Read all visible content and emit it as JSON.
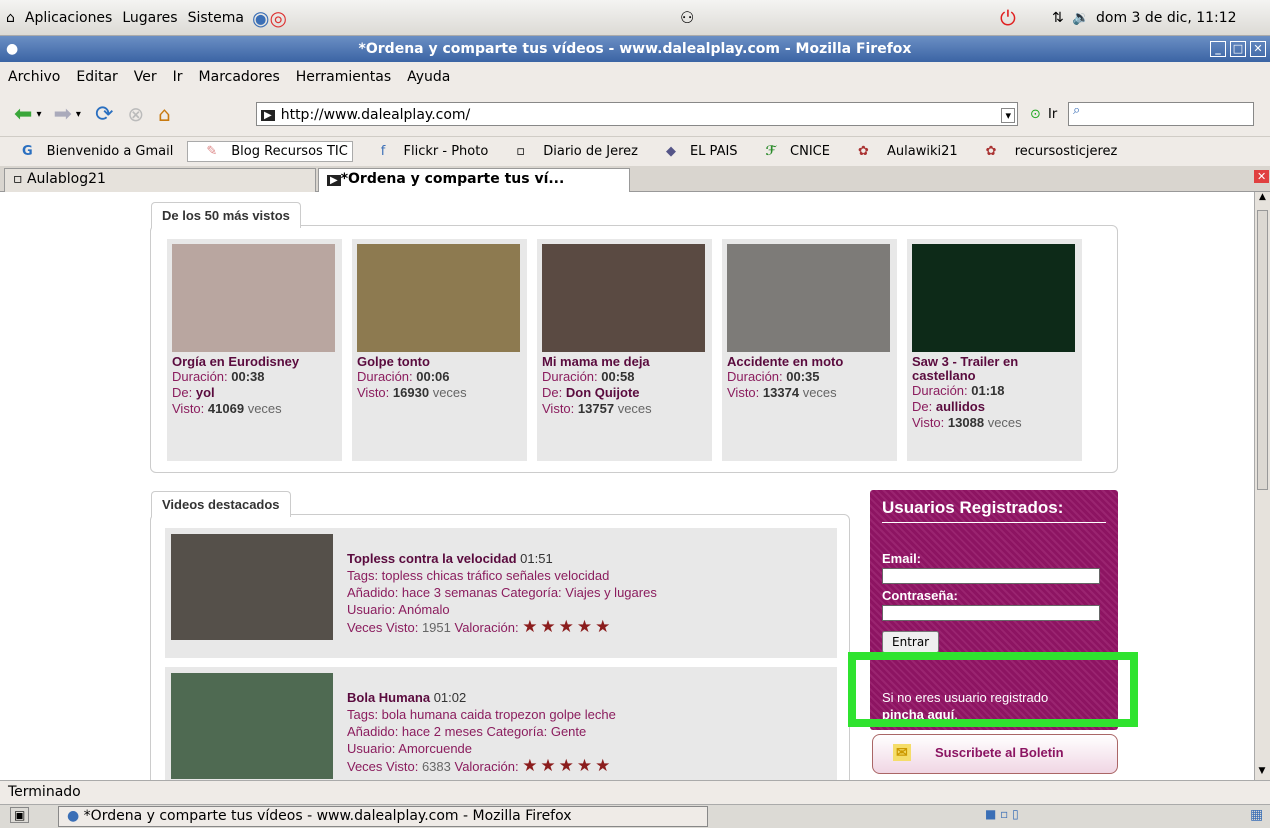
{
  "gnome_panel": {
    "menus": [
      "Aplicaciones",
      "Lugares",
      "Sistema"
    ],
    "clock": "dom 3 de dic, 11:12"
  },
  "window": {
    "title": "*Ordena y comparte tus vídeos - www.dalealplay.com - Mozilla Firefox"
  },
  "menubar": [
    "Archivo",
    "Editar",
    "Ver",
    "Ir",
    "Marcadores",
    "Herramientas",
    "Ayuda"
  ],
  "navbar": {
    "url": "http://www.dalealplay.com/",
    "go_label": "Ir"
  },
  "bookmarks": [
    "Bienvenido a Gmail",
    "Blog Recursos TIC",
    "Flickr - Photo",
    "Diario de Jerez",
    "EL PAIS",
    "CNICE",
    "Aulawiki21",
    "recursosticjerez"
  ],
  "tabs": [
    "Aulablog21",
    "*Ordena y comparte tus ví..."
  ],
  "top_videos": {
    "heading": "De los 50 más vistos",
    "items": [
      {
        "title": "Orgía en Eurodisney",
        "duracion_label": "Duración:",
        "duracion": "00:38",
        "de_label": "De:",
        "de": "yol",
        "visto_label": "Visto:",
        "visto": "41069",
        "veces": "veces",
        "color": "#b9a6a0"
      },
      {
        "title": "Golpe tonto",
        "duracion_label": "Duración:",
        "duracion": "00:06",
        "visto_label": "Visto:",
        "visto": "16930",
        "veces": "veces",
        "color": "#8d7a50"
      },
      {
        "title": "Mi mama me deja",
        "duracion_label": "Duración:",
        "duracion": "00:58",
        "de_label": "De:",
        "de": "Don Quijote",
        "visto_label": "Visto:",
        "visto": "13757",
        "veces": "veces",
        "color": "#5a4a42"
      },
      {
        "title": "Accidente en moto",
        "duracion_label": "Duración:",
        "duracion": "00:35",
        "visto_label": "Visto:",
        "visto": "13374",
        "veces": "veces",
        "color": "#7d7b78"
      },
      {
        "title": "Saw 3 - Trailer en castellano",
        "duracion_label": "Duración:",
        "duracion": "01:18",
        "de_label": "De:",
        "de": "aullidos",
        "visto_label": "Visto:",
        "visto": "13088",
        "veces": "veces",
        "color": "#0d2a18"
      }
    ]
  },
  "featured": {
    "heading": "Videos destacados",
    "items": [
      {
        "title": "Topless contra la velocidad",
        "time": "01:51",
        "tags": "Tags: topless chicas tráfico señales velocidad",
        "added": "Añadido: hace 3 semanas",
        "cat_label": "Categoría:",
        "cat": "Viajes y lugares",
        "user": "Usuario: Anómalo",
        "views_label": "Veces Visto:",
        "views": "1951",
        "rating_label": "Valoración:",
        "stars": "★★★★★",
        "color": "#55504a"
      },
      {
        "title": "Bola Humana",
        "time": "01:02",
        "tags": "Tags: bola humana caida tropezon golpe leche",
        "added": "Añadido: hace 2 meses",
        "cat_label": "Categoría:",
        "cat": "Gente",
        "user": "Usuario: Amorcuende",
        "views_label": "Veces Visto:",
        "views": "6383",
        "rating_label": "Valoración:",
        "stars": "★★★★★",
        "color": "#4f6a52"
      }
    ]
  },
  "login": {
    "title": "Usuarios Registrados:",
    "email_label": "Email:",
    "password_label": "Contraseña:",
    "submit": "Entrar",
    "register_text": "Si no eres usuario registrado",
    "register_link": "pincha aquí",
    "register_tail": "."
  },
  "newsletter": {
    "label": "Suscribete al Boletin"
  },
  "status": "Terminado",
  "taskbar": {
    "window": "*Ordena y comparte tus vídeos - www.dalealplay.com - Mozilla Firefox"
  }
}
